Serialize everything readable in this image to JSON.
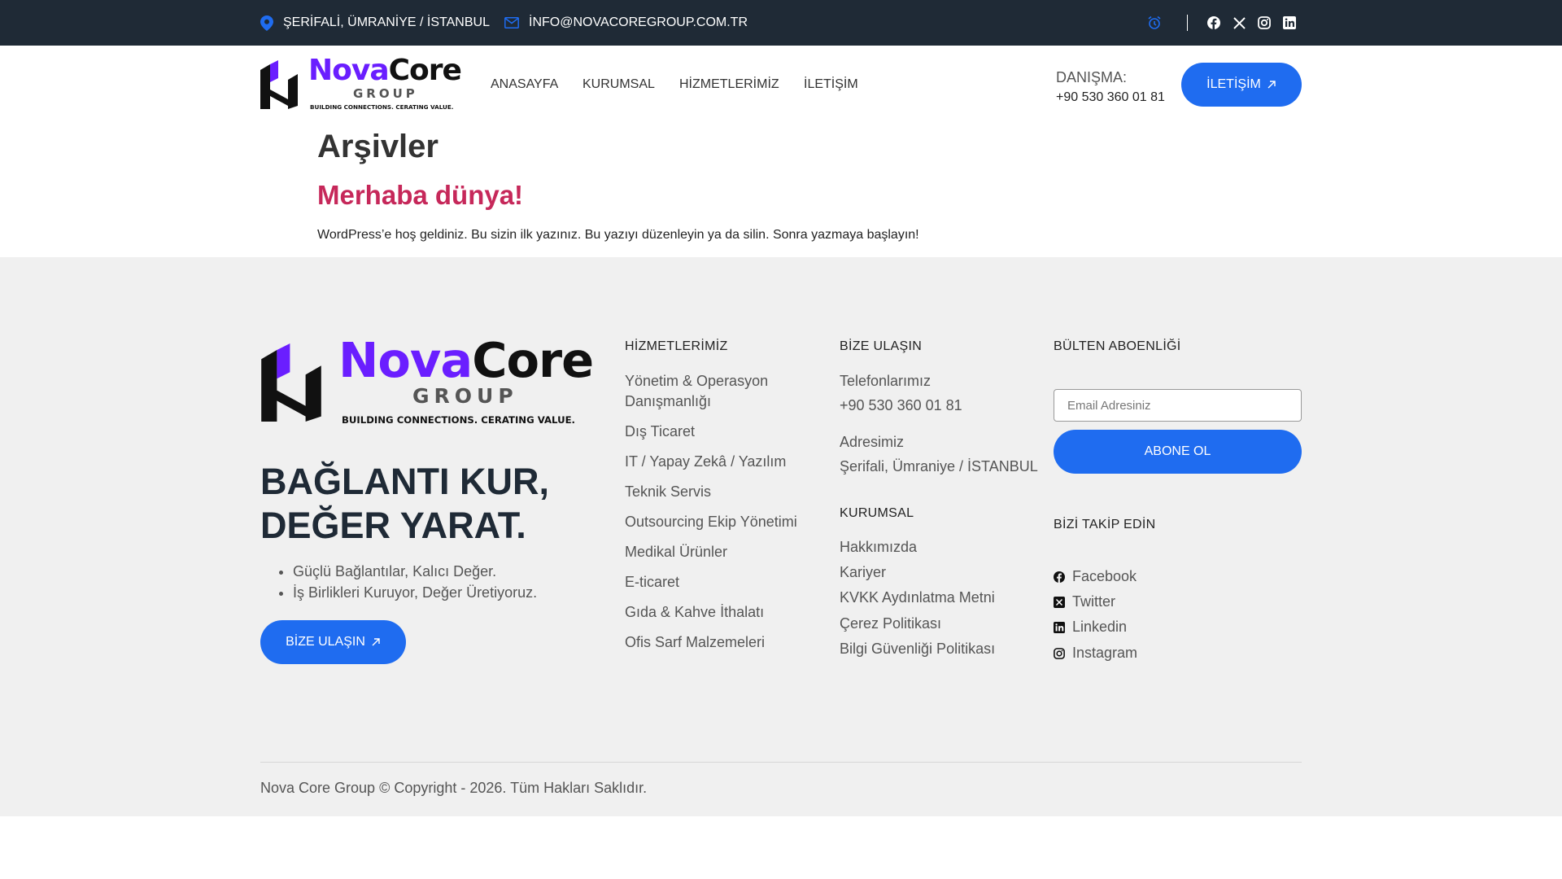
{
  "topbar": {
    "address": "ŞERİFALİ, ÜMRANİYE / İSTANBUL",
    "email": "İNFO@NOVACOREGROUP.COM.TR",
    "icons": [
      "map-pin-icon",
      "mail-icon",
      "alarm-clock-icon",
      "facebook-icon",
      "x-icon",
      "instagram-icon",
      "linkedin-icon"
    ]
  },
  "logo": {
    "nova": "Nova",
    "core": "Core",
    "group": "GROUP",
    "tagline": "BUILDING CONNECTIONS. CERATING VALUE."
  },
  "nav": {
    "items": [
      "ANASAYFA",
      "KURUMSAL",
      "HİZMETLERİMİZ",
      "İLETİŞİM"
    ]
  },
  "header": {
    "consult_label": "DANIŞMA:",
    "consult_phone": "+90 530 360 01 81",
    "contact_button": "İLETİŞİM"
  },
  "content": {
    "page_title": "Arşivler",
    "post_title": "Merhaba dünya!",
    "post_excerpt": "WordPress’e hoş geldiniz. Bu sizin ilk yazınız. Bu yazıyı düzenleyin ya da silin. Sonra yazmaya başlayın!"
  },
  "footer": {
    "slogan_line1": "BAĞLANTI KUR,",
    "slogan_line2": "DEĞER YARAT.",
    "bullets": [
      "Güçlü Bağlantılar, Kalıcı Değer.",
      "İş Birlikleri Kuruyor, Değer Üretiyoruz."
    ],
    "cta_button": "BİZE ULAŞIN",
    "services": {
      "title": "HİZMETLERİMİZ",
      "items": [
        "Yönetim & Operasyon",
        "Danışmanlığı",
        "Dış Ticaret",
        "IT / Yapay Zekâ / Yazılım",
        "Teknik Servis",
        "Outsourcing Ekip Yönetimi",
        "Medikal Ürünler",
        "E-ticaret",
        "Gıda & Kahve İthalatı",
        "Ofis Sarf Malzemeleri"
      ]
    },
    "contact": {
      "title": "BİZE ULAŞIN",
      "phones_label": "Telefonlarımız",
      "phone": "+90 530 360 01 81",
      "address_label": "Adresimiz",
      "address": "Şerifali, Ümraniye / İSTANBUL"
    },
    "corporate": {
      "title": "KURUMSAL",
      "items": [
        "Hakkımızda",
        "Kariyer",
        "KVKK Aydınlatma Metni",
        "Çerez Politikası",
        "Bilgi Güvenliği Politikası"
      ]
    },
    "newsletter": {
      "title": "BÜLTEN ABOENLİĞİ",
      "placeholder": "Email Adresiniz",
      "button": "ABONE OL"
    },
    "follow": {
      "title": "BİZİ TAKİP EDİN",
      "items": [
        "Facebook",
        "Twitter",
        "Linkedin",
        "Instagram"
      ]
    },
    "copyright": "Nova Core Group © Copyright - 2026. Tüm Hakları Saklıdır."
  },
  "colors": {
    "topbar_bg": "#1f2a36",
    "accent_blue": "#1f6cf0",
    "post_title": "#c6285a",
    "logo_purple": "#6a1eff",
    "footer_bg": "#f0f0f0"
  }
}
